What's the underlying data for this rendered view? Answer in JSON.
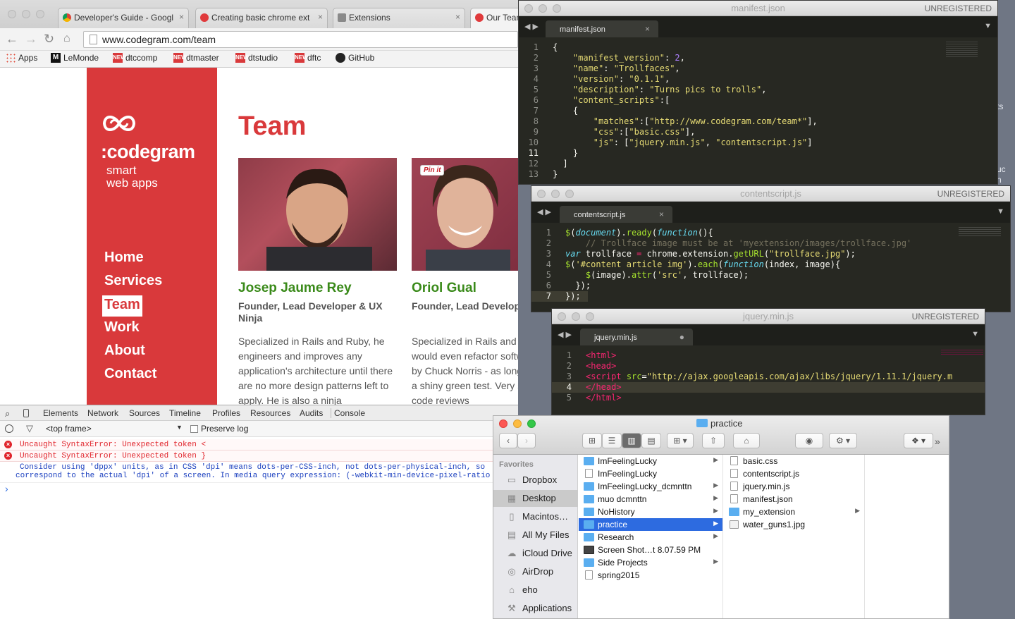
{
  "desktop": {
    "edge_text_1": "ts",
    "edge_text_2": "uc",
    "edge_text_3": "n"
  },
  "chrome": {
    "tabs": [
      {
        "label": "Developer's Guide - Googl",
        "close": "×"
      },
      {
        "label": "Creating basic chrome ext",
        "close": "×"
      },
      {
        "label": "Extensions",
        "close": "×"
      },
      {
        "label": "Our Team",
        "close": ""
      }
    ],
    "url": "www.codegram.com/team",
    "bookmarks": [
      "Apps",
      "LeMonde",
      "dtccomp",
      "dtmaster",
      "dtstudio",
      "dftc",
      "GitHub"
    ],
    "bookmark_badge": "NEW",
    "lemonde_badge": "M"
  },
  "site": {
    "brand": ":codegram",
    "tagline1": "smart",
    "tagline2": "web apps",
    "nav": [
      "Home",
      "Services",
      "Team",
      "Work",
      "About",
      "Contact"
    ],
    "heading": "Team",
    "pinit": "Pin it",
    "people": [
      {
        "name": "Josep Jaume Rey",
        "role": "Founder, Lead Developer & UX Ninja",
        "bio": "Specialized in Rails and Ruby, he engineers and improves any application's architecture until there are no more design patterns left to apply. He is also a ninja"
      },
      {
        "name": "Oriol Gual",
        "role": "Founder, Lead Developer & Refactor Chief",
        "bio": "Specialized in Rails and Ruby, he would even refactor software made by Chuck Norris - as long as it has a shiny green test. Very strict in code reviews"
      }
    ]
  },
  "devtools": {
    "tabs": [
      "Elements",
      "Network",
      "Sources",
      "Timeline",
      "Profiles",
      "Resources",
      "Audits",
      "Console"
    ],
    "frame": "<top frame>",
    "preserve_log": "Preserve log",
    "errors": [
      "Uncaught SyntaxError: Unexpected token <",
      "Uncaught SyntaxError: Unexpected token }"
    ],
    "warning1": "Consider using 'dppx' units, as in CSS 'dpi' means dots-per-CSS-inch, not dots-per-physical-inch, so",
    "warning2": "correspond to the actual 'dpi' of a screen. In media query expression: (-webkit-min-device-pixel-ratio",
    "prompt": "›"
  },
  "sublime": {
    "unregistered": "UNREGISTERED",
    "manifest": {
      "title": "manifest.json",
      "tab": "manifest.json"
    },
    "contentscript": {
      "title": "contentscript.js",
      "tab": "contentscript.js"
    },
    "jquery": {
      "title": "jquery.min.js",
      "tab": "jquery.min.js"
    }
  },
  "finder": {
    "title": "practice",
    "favorites_label": "Favorites",
    "sidebar": [
      "Dropbox",
      "Desktop",
      "Macintos…",
      "All My Files",
      "iCloud Drive",
      "AirDrop",
      "eho",
      "Applications"
    ],
    "col1": [
      "ImFeelingLucky",
      "ImFeelingLucky",
      "ImFeelingLucky_dcmnttn",
      "muo dcmnttn",
      "NoHistory",
      "practice",
      "Research",
      "Screen Shot…t 8.07.59 PM",
      "Side Projects",
      "spring2015"
    ],
    "col2": [
      "basic.css",
      "contentscript.js",
      "jquery.min.js",
      "manifest.json",
      "my_extension",
      "water_guns1.jpg"
    ]
  }
}
